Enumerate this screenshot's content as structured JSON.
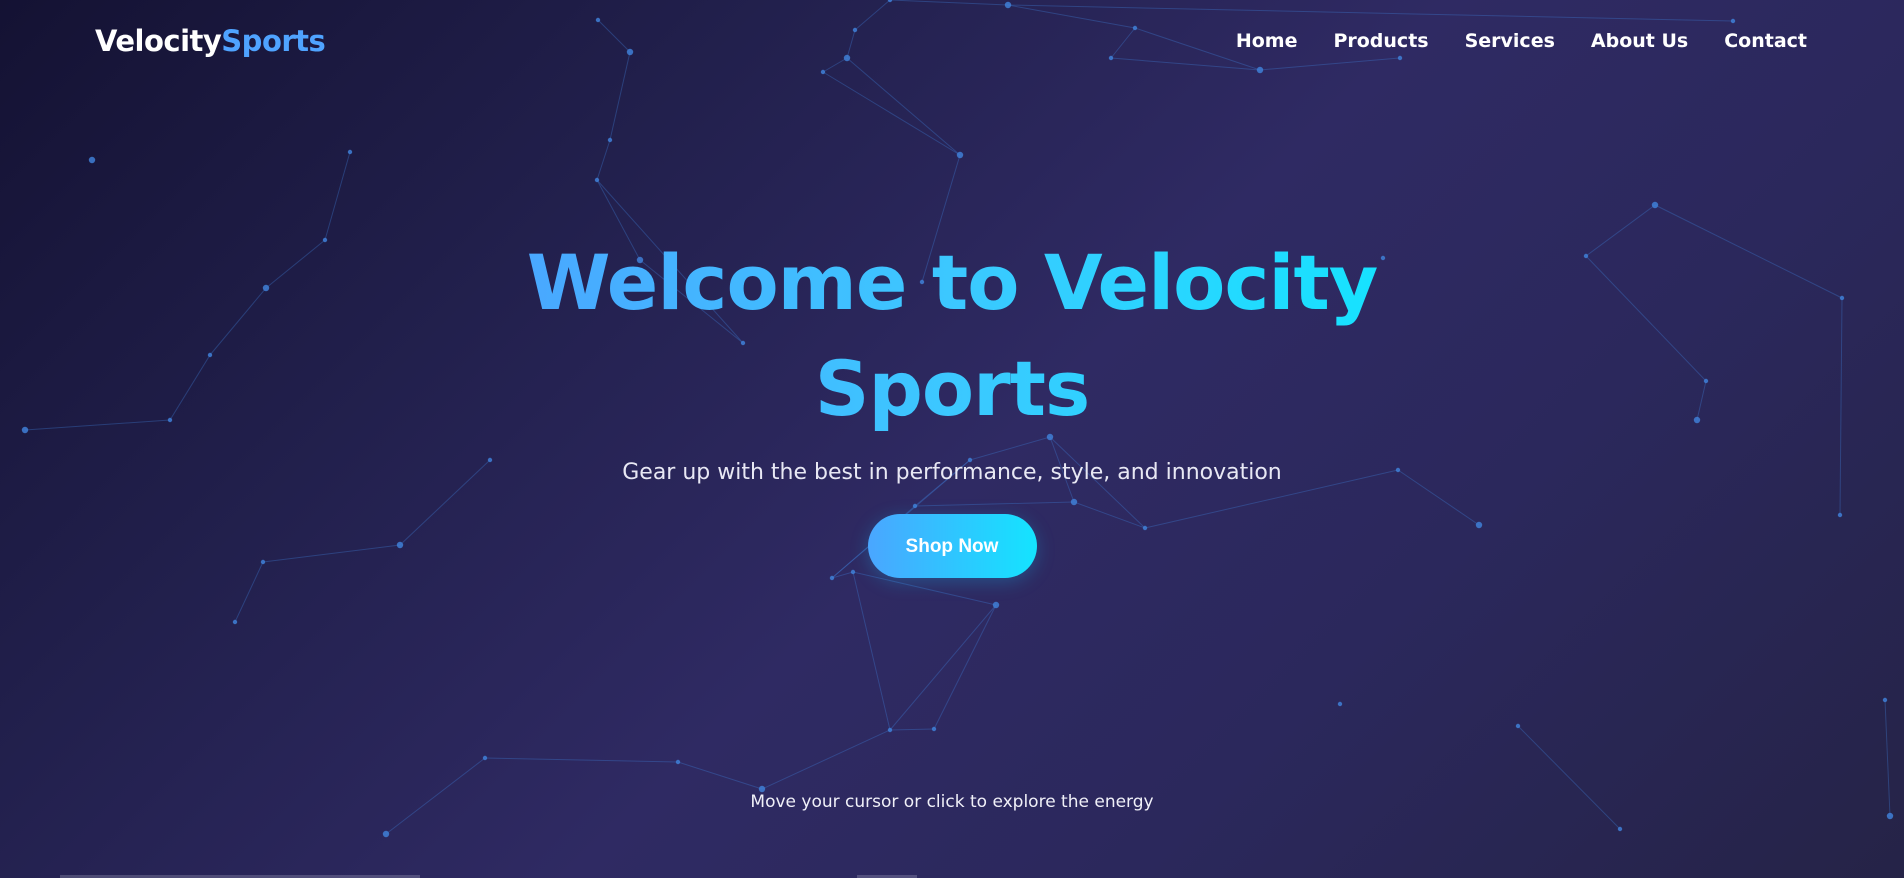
{
  "brand": {
    "name_primary": "Velocity",
    "name_accent": "Sports"
  },
  "nav": {
    "items": [
      {
        "label": "Home"
      },
      {
        "label": "Products"
      },
      {
        "label": "Services"
      },
      {
        "label": "About Us"
      },
      {
        "label": "Contact"
      }
    ]
  },
  "hero": {
    "title": "Welcome to Velocity Sports",
    "subtitle": "Gear up with the best in performance, style, and innovation",
    "cta_label": "Shop Now"
  },
  "hint": {
    "text": "Move your cursor or click to explore the energy"
  },
  "colors": {
    "background_dark": "#141233",
    "background_mid": "#2f2a63",
    "brand_accent": "#4fa3ff",
    "gradient_start": "#4aa6ff",
    "gradient_end": "#14e4ff",
    "particle": "#3f7fd6"
  }
}
